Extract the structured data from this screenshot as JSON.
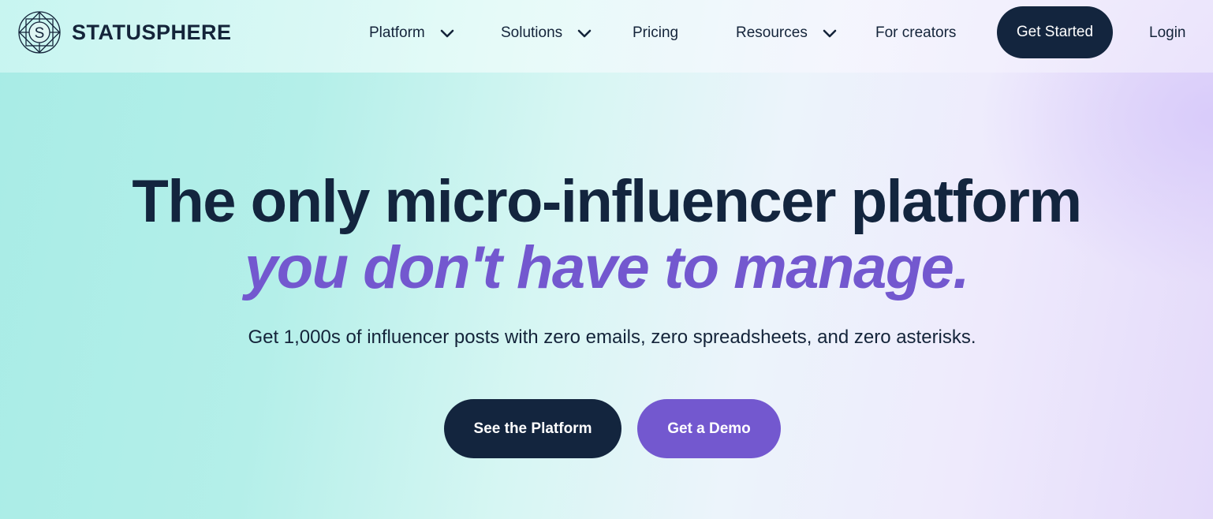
{
  "brand": {
    "name": "STATUSPHERE",
    "logo_letter": "S"
  },
  "nav": {
    "items": [
      {
        "label": "Platform",
        "has_dropdown": true
      },
      {
        "label": "Solutions",
        "has_dropdown": true
      },
      {
        "label": "Pricing",
        "has_dropdown": false
      },
      {
        "label": "Resources",
        "has_dropdown": true
      },
      {
        "label": "For creators",
        "has_dropdown": false
      }
    ],
    "get_started": "Get Started",
    "login": "Login"
  },
  "hero": {
    "headline": "The only micro-influencer platform",
    "headline_accent": "you don't have to manage.",
    "subheadline": "Get 1,000s of influencer posts with zero emails, zero spreadsheets, and zero asterisks.",
    "primary_cta": "See the Platform",
    "secondary_cta": "Get a Demo"
  },
  "colors": {
    "navy": "#13253e",
    "purple": "#7358cf",
    "mint": "#a8ece6",
    "lavender": "#e4dafa"
  },
  "icons": [
    "statusphere-logo-icon",
    "chevron-down-icon"
  ]
}
